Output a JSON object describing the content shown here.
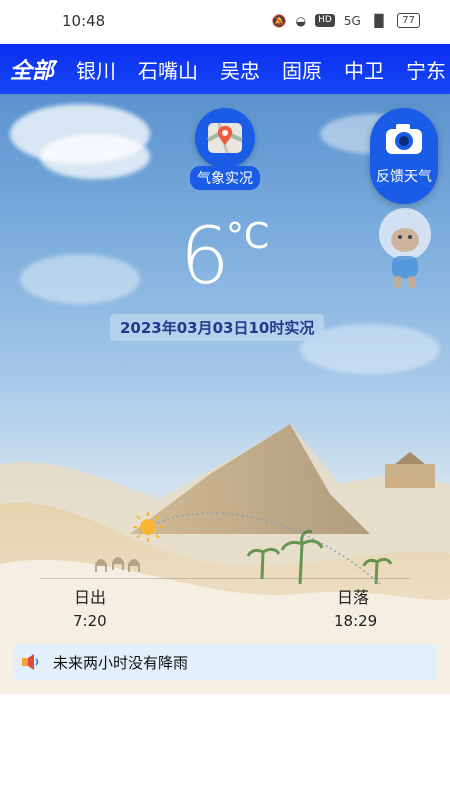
{
  "status": {
    "time": "10:48",
    "battery": "77",
    "signal": "5G",
    "hd": "HD"
  },
  "nav": {
    "tabs": [
      "全部",
      "银川",
      "石嘴山",
      "吴忠",
      "固原",
      "中卫",
      "宁东"
    ]
  },
  "map_button": {
    "label": "气象实况",
    "icon": "map-pin-icon"
  },
  "feedback_button": {
    "label": "反馈天气",
    "icon": "camera-icon"
  },
  "weather": {
    "temperature": "6",
    "unit": "°C",
    "observation_time": "2023年03月03日10时实况"
  },
  "sun": {
    "sunrise_label": "日出",
    "sunrise_time": "7:20",
    "sunset_label": "日落",
    "sunset_time": "18:29"
  },
  "notice": {
    "text": "未来两小时没有降雨",
    "icon": "speaker-icon"
  },
  "colors": {
    "nav": "#0a2ef0",
    "accent": "#1a5ce6",
    "notice_bg": "#e3f0fb"
  }
}
